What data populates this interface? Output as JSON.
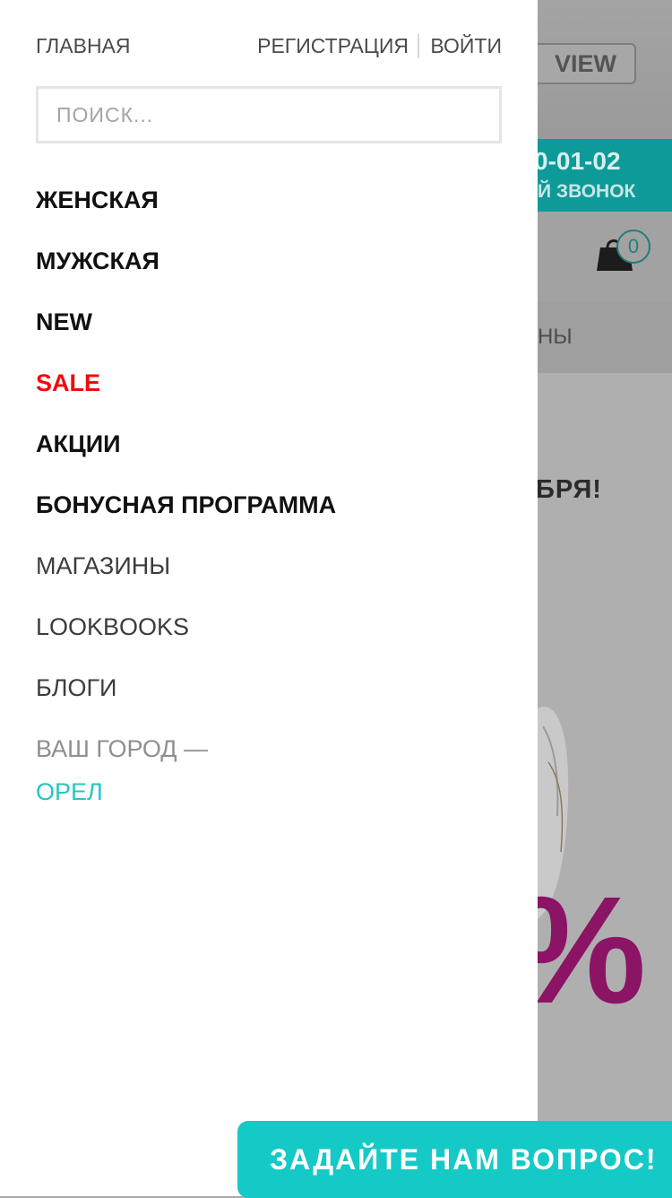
{
  "drawer": {
    "home_link": "ГЛАВНАЯ",
    "register_link": "РЕГИСТРАЦИЯ",
    "login_link": "ВОЙТИ",
    "search_placeholder": "ПОИСК...",
    "menu": [
      {
        "label": "ЖЕНСКАЯ",
        "style": "bold"
      },
      {
        "label": "МУЖСКАЯ",
        "style": "bold"
      },
      {
        "label": "NEW",
        "style": "bold"
      },
      {
        "label": "SALE",
        "style": "bold-red"
      },
      {
        "label": "АКЦИИ",
        "style": "bold"
      },
      {
        "label": "БОНУСНАЯ ПРОГРАММА",
        "style": "bold"
      },
      {
        "label": "МАГАЗИНЫ",
        "style": "light"
      },
      {
        "label": "LOOKBOOKS",
        "style": "light"
      },
      {
        "label": "БЛОГИ",
        "style": "light"
      }
    ],
    "city_label": "ВАШ ГОРОД —",
    "city_value": "ОРЕЛ"
  },
  "background_page": {
    "view_button": "VIEW",
    "phone_fragment": "0-01-02",
    "callback_fragment": "Й ЗВОНОК",
    "cart_count": "0",
    "menu_fragment": "НЫ",
    "promo_fragment": "БРЯ!",
    "percent_fragment": "%"
  },
  "ask_button": "ЗАДАЙТЕ НАМ ВОПРОС!",
  "colors": {
    "sale": "#ee0d0d",
    "city": "#25c5c3",
    "accent_teal": "#14c9c6",
    "promo_magenta": "#8b1465"
  },
  "icons": {
    "cart": "shopping-bag-icon"
  }
}
